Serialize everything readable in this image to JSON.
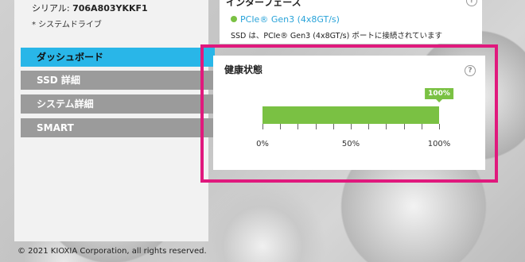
{
  "sidebar": {
    "serial_label": "シリアル: ",
    "serial_value": "706A803YKKF1",
    "system_drive": "* システムドライブ",
    "nav": [
      {
        "label": "ダッシュボード",
        "active": true
      },
      {
        "label": "SSD 詳細",
        "active": false
      },
      {
        "label": "システム詳細",
        "active": false
      },
      {
        "label": "SMART",
        "active": false
      }
    ]
  },
  "interface": {
    "title": "インターフェース",
    "speed": "PCIe® Gen3 (4x8GT/s)",
    "description": "SSD は、PCIe® Gen3 (4x8GT/s) ポートに接続されています",
    "help_icon": "?"
  },
  "health": {
    "title": "健康状態",
    "help_icon": "?",
    "value_percent": 100,
    "badge": "100%",
    "scale_labels": [
      "0%",
      "50%",
      "100%"
    ],
    "colors": {
      "fill": "#7ac143",
      "highlight": "#e0197d",
      "active_nav": "#29b6e8"
    }
  },
  "footer": {
    "copyright": "© 2021 KIOXIA Corporation, all rights reserved."
  }
}
